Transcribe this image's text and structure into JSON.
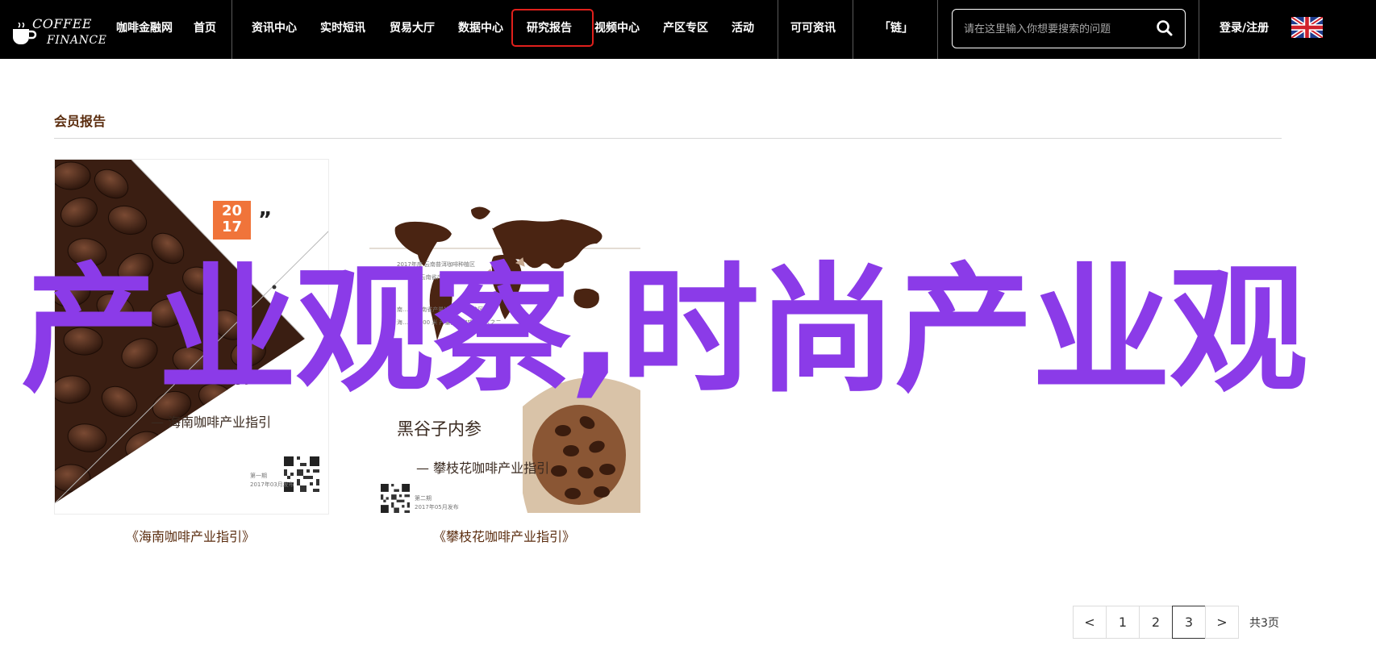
{
  "brand": {
    "line1": "COFFEE",
    "line2": "FINANCE"
  },
  "nav": {
    "items": [
      "咖啡金融网",
      "首页",
      "资讯中心",
      "实时短讯",
      "贸易大厅",
      "数据中心",
      "研究报告",
      "视频中心",
      "产区专区",
      "活动",
      "可可资讯",
      "「链」"
    ],
    "active": "研究报告",
    "login": "登录/注册",
    "language_icon": "uk-flag-icon"
  },
  "search": {
    "placeholder": "请在这里输入你想要搜索的问题",
    "icon": "search-icon"
  },
  "section": {
    "title": "会员报告"
  },
  "reports": [
    {
      "caption": "《海南咖啡产业指引》",
      "cover": {
        "year_top": "20",
        "year_bottom": "17",
        "quote": "”",
        "title": "黑谷子内参",
        "subtitle": "— 海南咖啡产业指引",
        "note1": "第一期",
        "note2": "2017年03月发布"
      }
    },
    {
      "caption": "《攀枝花咖啡产业指引》",
      "cover": {
        "title": "黑谷子内参",
        "subtitle": "— 攀枝花咖啡产业指引",
        "map_labels": [
          "2017年度 云南普洱咖啡种植区",
          "北纬26° 云南省产量排名咖啡种植区",
          "南…… 海南省产量排名咖啡种植区之一",
          "海…… 1500 米 产量排名咖啡种植区之二"
        ],
        "note1": "第二期",
        "note2": "2017年05月发布"
      }
    }
  ],
  "overlay": {
    "text": "产业观察,时尚产业观"
  },
  "pagination": {
    "prev": "<",
    "pages": [
      "1",
      "2",
      "3"
    ],
    "current": "3",
    "next": ">",
    "total": "共3页"
  },
  "colors": {
    "accent_brown": "#5b2d0f",
    "overlay_purple": "#8b3be8",
    "active_border": "#e0201c",
    "cover_orange": "#f0743a"
  }
}
